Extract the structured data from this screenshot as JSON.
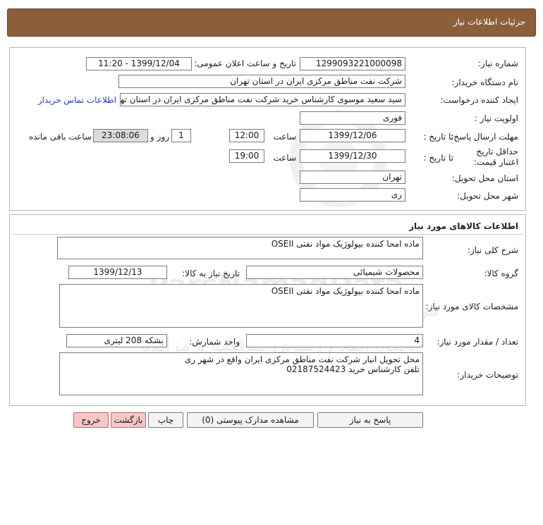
{
  "header": {
    "title": "جزئیات اطلاعات نیاز"
  },
  "watermark": {
    "brand": "ParsNamadData",
    "line1": "مرکز فرآوری اطلاعات پارس نماد داده ها",
    "line2": "پایگاه اطلاع رسانی مناقصه و مزایده",
    "phone": "۰۲۱-۸۸۳۴۹۶۷۰"
  },
  "info": {
    "need_number_label": "شماره نیاز:",
    "need_number": "1299093221000098",
    "announce_label": "تاریخ و ساعت اعلان عمومی:",
    "announce_value": "1399/12/04 - 11:20",
    "buyer_org_label": "نام دستگاه خریدار:",
    "buyer_org": "شرکت نفت مناطق مرکزی ایران در استان تهران",
    "requester_label": "ایجاد کننده درخواست:",
    "requester": "سید سعید موسوی کارشناس خرید شرکت نفت مناطق مرکزی ایران در استان تهران",
    "contact_link": "اطلاعات تماس خریدار",
    "priority_label": "اولویت نیاز :",
    "priority": "فوری",
    "deadline_label": "مهلت ارسال پاسخ:",
    "to_date_label": "تا تاریخ :",
    "deadline_date": "1399/12/06",
    "time_label": "ساعت",
    "deadline_time": "12:00",
    "days_value": "1",
    "days_and_label": "روز و",
    "remaining_time": "23:08:06",
    "remaining_label": "ساعت باقی مانده",
    "price_validity_label": "حداقل تاریخ اعتبار قیمت:",
    "validity_to_label": "تا تاریخ :",
    "validity_date": "1399/12/30",
    "validity_time_label": "ساعت",
    "validity_time": "19:00",
    "province_label": "استان محل تحویل:",
    "province": "تهران",
    "city_label": "شهر محل تحویل:",
    "city": "ری"
  },
  "goods": {
    "section_title": "اطلاعات کالاهای مورد نیاز",
    "summary_label": "شرح کلی نیاز:",
    "summary": "ماده امحا کننده بیولوژیک مواد نفتی OSEII",
    "group_label": "گروه کالا:",
    "group": "محصولات شیمیائی",
    "need_date_label": "تاریخ نیاز به کالا:",
    "need_date": "1399/12/13",
    "specs_label": "مشخصات کالای مورد نیاز:",
    "specs": "ماده امحا کننده بیولوژیک مواد نفتی OSEII",
    "quantity_label": "تعداد / مقدار مورد نیاز:",
    "quantity": "4",
    "unit_label": "واحد شمارش:",
    "unit": "بشکه 208 لیتری",
    "buyer_notes_label": "توضیحات خریدار:",
    "buyer_notes_line1": "محل تحویل انبار شرکت نفت مناطق مرکزی ایران واقع در شهر ری",
    "buyer_notes_line2": "تلفن کارشناس خرید 02187524423"
  },
  "buttons": {
    "reply": "پاسخ به نیاز",
    "attachments": "مشاهده مدارک پیوستی (0)",
    "print": "چاپ",
    "back": "بازگشت",
    "exit": "خروج"
  }
}
